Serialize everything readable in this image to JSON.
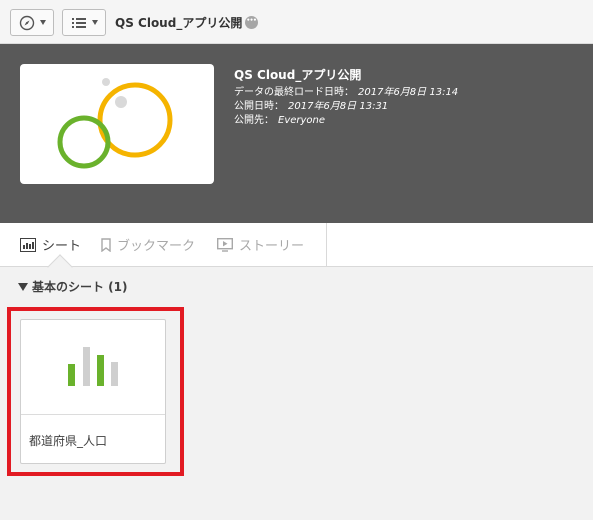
{
  "toolbar": {
    "nav_icon": "compass-icon",
    "list_icon": "list-icon",
    "app_title": "QS Cloud_アプリ公開",
    "more_icon": "more-icon"
  },
  "header": {
    "title": "QS Cloud_アプリ公開",
    "last_load_label": "データの最終ロード日時：",
    "last_load_value": "2017年6月8日 13:14",
    "published_label": "公開日時：",
    "published_value": "2017年6月8日 13:31",
    "published_to_label": "公開先：",
    "published_to_value": "Everyone"
  },
  "tabs": {
    "sheet": "シート",
    "bookmark": "ブックマーク",
    "story": "ストーリー"
  },
  "section": {
    "title": "基本のシート (1)"
  },
  "sheets": [
    {
      "label": "都道府県_人口"
    }
  ],
  "colors": {
    "header_bg": "#595959",
    "accent_green": "#6ab22c",
    "accent_yellow": "#f5b400",
    "highlight_red": "#e21b23"
  }
}
